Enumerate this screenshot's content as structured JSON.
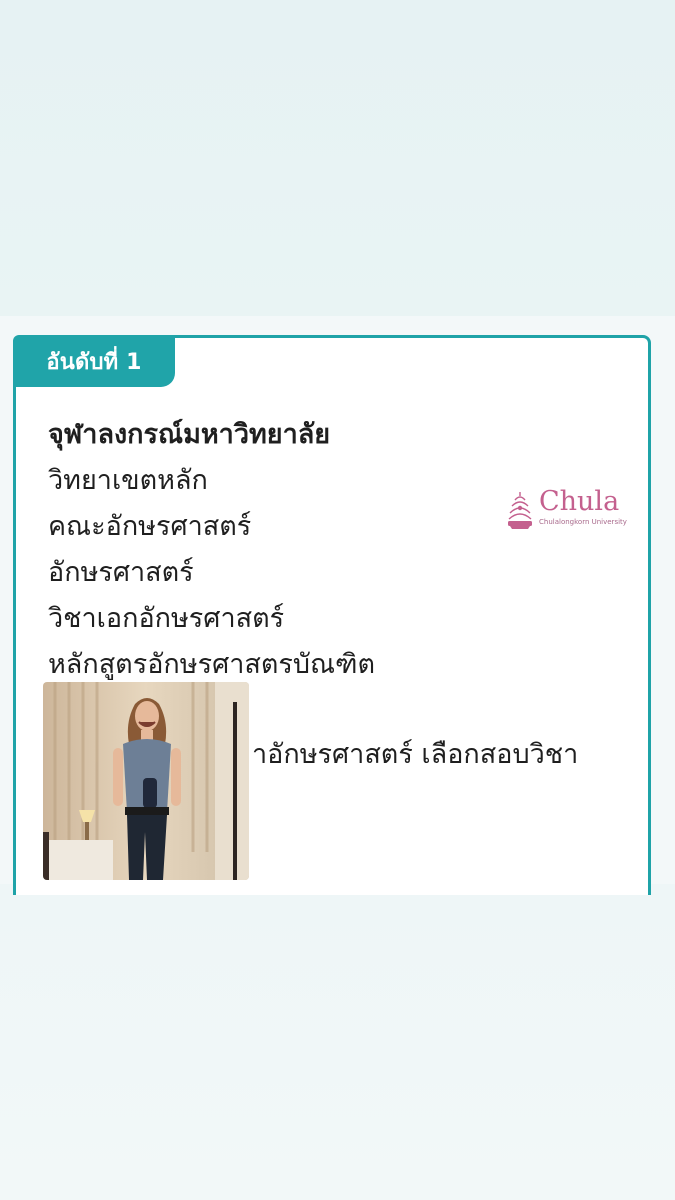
{
  "rank": {
    "label": "อันดับที่ 1"
  },
  "entry": {
    "university": "จุฬาลงกรณ์มหาวิทยาลัย",
    "campus": "วิทยาเขตหลัก",
    "faculty": "คณะอักษรศาสตร์",
    "field": "อักษรศาสตร์",
    "major": "วิชาเอกอักษรศาสตร์",
    "program": "หลักสูตรอักษรศาสตรบัณฑิต",
    "partial_line": "าอักษรศาสตร์ เลือกสอบวิชา"
  },
  "logo": {
    "wordmark": "Chula",
    "subtitle": "Chulalongkorn University",
    "icon": "chula-crest-icon",
    "color": "#c4608e"
  },
  "photo": {
    "icon": "person-crying-photo"
  },
  "colors": {
    "accent": "#20a4a9",
    "text": "#1f1f1f",
    "background": "#f1f7f8"
  }
}
